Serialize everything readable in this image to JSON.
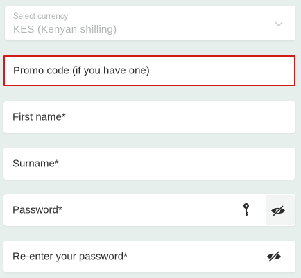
{
  "currency": {
    "label": "Select currency",
    "value": "KES  (Kenyan shilling)",
    "icon": "chevron-down-icon"
  },
  "promo": {
    "placeholder": "Promo code (if you have one)",
    "highlight_color": "#d21a1a"
  },
  "first_name": {
    "placeholder": "First name*"
  },
  "surname": {
    "placeholder": "Surname*"
  },
  "password": {
    "placeholder": "Password*",
    "icons": [
      "key-icon",
      "eye-slash-icon"
    ]
  },
  "repassword": {
    "placeholder": "Re-enter your password*",
    "icons": [
      "eye-slash-icon"
    ]
  },
  "colors": {
    "background": "#e6efec",
    "field": "#ffffff",
    "text": "#2b2b2b",
    "muted": "#b0b4b4"
  }
}
